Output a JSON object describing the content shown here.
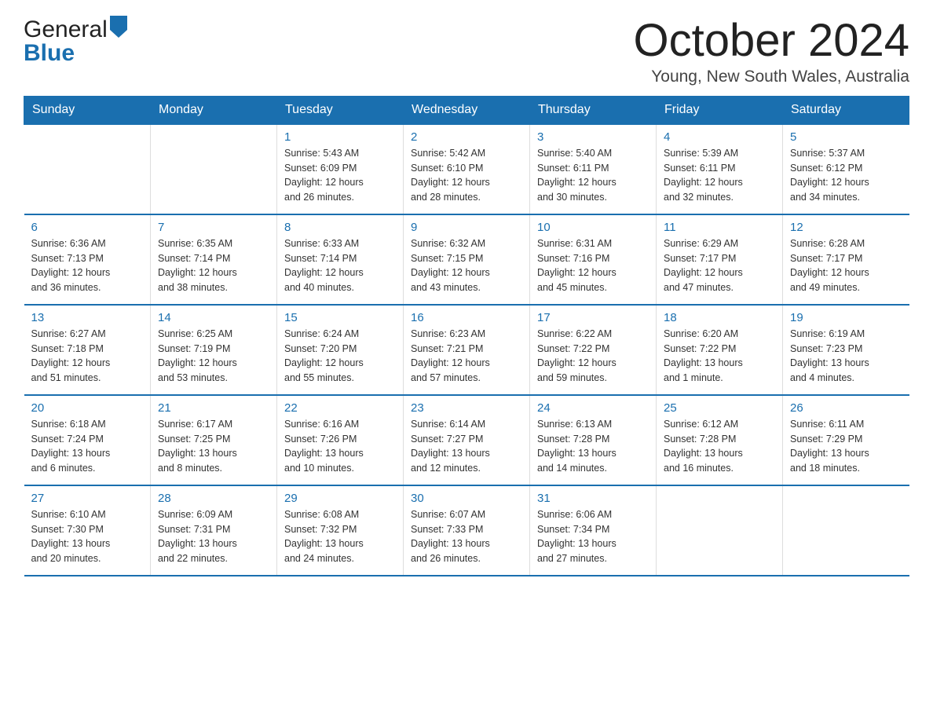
{
  "header": {
    "logo_general": "General",
    "logo_blue": "Blue",
    "month_title": "October 2024",
    "location": "Young, New South Wales, Australia"
  },
  "days_of_week": [
    "Sunday",
    "Monday",
    "Tuesday",
    "Wednesday",
    "Thursday",
    "Friday",
    "Saturday"
  ],
  "weeks": [
    [
      {
        "day": "",
        "info": ""
      },
      {
        "day": "",
        "info": ""
      },
      {
        "day": "1",
        "info": "Sunrise: 5:43 AM\nSunset: 6:09 PM\nDaylight: 12 hours\nand 26 minutes."
      },
      {
        "day": "2",
        "info": "Sunrise: 5:42 AM\nSunset: 6:10 PM\nDaylight: 12 hours\nand 28 minutes."
      },
      {
        "day": "3",
        "info": "Sunrise: 5:40 AM\nSunset: 6:11 PM\nDaylight: 12 hours\nand 30 minutes."
      },
      {
        "day": "4",
        "info": "Sunrise: 5:39 AM\nSunset: 6:11 PM\nDaylight: 12 hours\nand 32 minutes."
      },
      {
        "day": "5",
        "info": "Sunrise: 5:37 AM\nSunset: 6:12 PM\nDaylight: 12 hours\nand 34 minutes."
      }
    ],
    [
      {
        "day": "6",
        "info": "Sunrise: 6:36 AM\nSunset: 7:13 PM\nDaylight: 12 hours\nand 36 minutes."
      },
      {
        "day": "7",
        "info": "Sunrise: 6:35 AM\nSunset: 7:14 PM\nDaylight: 12 hours\nand 38 minutes."
      },
      {
        "day": "8",
        "info": "Sunrise: 6:33 AM\nSunset: 7:14 PM\nDaylight: 12 hours\nand 40 minutes."
      },
      {
        "day": "9",
        "info": "Sunrise: 6:32 AM\nSunset: 7:15 PM\nDaylight: 12 hours\nand 43 minutes."
      },
      {
        "day": "10",
        "info": "Sunrise: 6:31 AM\nSunset: 7:16 PM\nDaylight: 12 hours\nand 45 minutes."
      },
      {
        "day": "11",
        "info": "Sunrise: 6:29 AM\nSunset: 7:17 PM\nDaylight: 12 hours\nand 47 minutes."
      },
      {
        "day": "12",
        "info": "Sunrise: 6:28 AM\nSunset: 7:17 PM\nDaylight: 12 hours\nand 49 minutes."
      }
    ],
    [
      {
        "day": "13",
        "info": "Sunrise: 6:27 AM\nSunset: 7:18 PM\nDaylight: 12 hours\nand 51 minutes."
      },
      {
        "day": "14",
        "info": "Sunrise: 6:25 AM\nSunset: 7:19 PM\nDaylight: 12 hours\nand 53 minutes."
      },
      {
        "day": "15",
        "info": "Sunrise: 6:24 AM\nSunset: 7:20 PM\nDaylight: 12 hours\nand 55 minutes."
      },
      {
        "day": "16",
        "info": "Sunrise: 6:23 AM\nSunset: 7:21 PM\nDaylight: 12 hours\nand 57 minutes."
      },
      {
        "day": "17",
        "info": "Sunrise: 6:22 AM\nSunset: 7:22 PM\nDaylight: 12 hours\nand 59 minutes."
      },
      {
        "day": "18",
        "info": "Sunrise: 6:20 AM\nSunset: 7:22 PM\nDaylight: 13 hours\nand 1 minute."
      },
      {
        "day": "19",
        "info": "Sunrise: 6:19 AM\nSunset: 7:23 PM\nDaylight: 13 hours\nand 4 minutes."
      }
    ],
    [
      {
        "day": "20",
        "info": "Sunrise: 6:18 AM\nSunset: 7:24 PM\nDaylight: 13 hours\nand 6 minutes."
      },
      {
        "day": "21",
        "info": "Sunrise: 6:17 AM\nSunset: 7:25 PM\nDaylight: 13 hours\nand 8 minutes."
      },
      {
        "day": "22",
        "info": "Sunrise: 6:16 AM\nSunset: 7:26 PM\nDaylight: 13 hours\nand 10 minutes."
      },
      {
        "day": "23",
        "info": "Sunrise: 6:14 AM\nSunset: 7:27 PM\nDaylight: 13 hours\nand 12 minutes."
      },
      {
        "day": "24",
        "info": "Sunrise: 6:13 AM\nSunset: 7:28 PM\nDaylight: 13 hours\nand 14 minutes."
      },
      {
        "day": "25",
        "info": "Sunrise: 6:12 AM\nSunset: 7:28 PM\nDaylight: 13 hours\nand 16 minutes."
      },
      {
        "day": "26",
        "info": "Sunrise: 6:11 AM\nSunset: 7:29 PM\nDaylight: 13 hours\nand 18 minutes."
      }
    ],
    [
      {
        "day": "27",
        "info": "Sunrise: 6:10 AM\nSunset: 7:30 PM\nDaylight: 13 hours\nand 20 minutes."
      },
      {
        "day": "28",
        "info": "Sunrise: 6:09 AM\nSunset: 7:31 PM\nDaylight: 13 hours\nand 22 minutes."
      },
      {
        "day": "29",
        "info": "Sunrise: 6:08 AM\nSunset: 7:32 PM\nDaylight: 13 hours\nand 24 minutes."
      },
      {
        "day": "30",
        "info": "Sunrise: 6:07 AM\nSunset: 7:33 PM\nDaylight: 13 hours\nand 26 minutes."
      },
      {
        "day": "31",
        "info": "Sunrise: 6:06 AM\nSunset: 7:34 PM\nDaylight: 13 hours\nand 27 minutes."
      },
      {
        "day": "",
        "info": ""
      },
      {
        "day": "",
        "info": ""
      }
    ]
  ]
}
